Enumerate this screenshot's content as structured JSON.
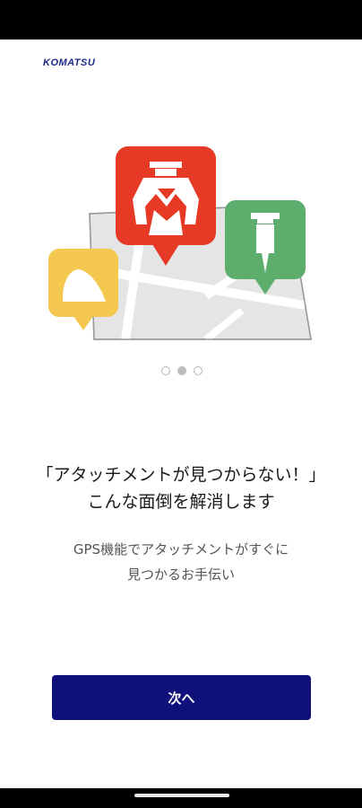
{
  "brand": {
    "logo_text": "KOMATSU",
    "logo_color": "#1b2a8a"
  },
  "carousel": {
    "total": 3,
    "active_index": 1
  },
  "headline": {
    "line1": "「アタッチメントが見つからない！」",
    "line2": "こんな面倒を解消します"
  },
  "subtext": {
    "line1": "GPS機能でアタッチメントがすぐに",
    "line2": "見つかるお手伝い"
  },
  "next_button": {
    "label": "次へ",
    "color": "#10107a"
  },
  "illustration": {
    "pins": [
      {
        "icon": "bucket-icon",
        "color": "#f4c84e"
      },
      {
        "icon": "crusher-icon",
        "color": "#e63a26"
      },
      {
        "icon": "breaker-icon",
        "color": "#5dae6c"
      }
    ],
    "map_color": "#e5e5e5"
  }
}
